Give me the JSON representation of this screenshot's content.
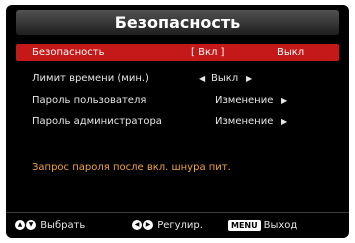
{
  "title": "Безопасность",
  "rows": [
    {
      "label": "Безопасность",
      "value_current": "[ Вкл ]",
      "value_alt": "Выкл",
      "selected": true
    },
    {
      "label": "Лимит времени (мин.)",
      "left_arrow": "◀",
      "value": "Выкл",
      "right_arrow": "▶",
      "selected": false
    },
    {
      "label": "Пароль пользователя",
      "value": "Изменение",
      "right_arrow": "▶",
      "selected": false
    },
    {
      "label": "Пароль администратора",
      "value": "Изменение",
      "right_arrow": "▶",
      "selected": false
    }
  ],
  "notice": "Запрос пароля после вкл. шнура пит.",
  "footer": {
    "select": {
      "icons": [
        "▲",
        "▼"
      ],
      "label": "Выбрать"
    },
    "adjust": {
      "icons": [
        "◀",
        "▶"
      ],
      "label": "Регулир."
    },
    "exit": {
      "key": "MENU",
      "label": "Выход"
    }
  },
  "colors": {
    "background": "#000000",
    "selected_row": "#c51818",
    "notice_text": "#f0a23c",
    "text": "#e6e6e6"
  }
}
